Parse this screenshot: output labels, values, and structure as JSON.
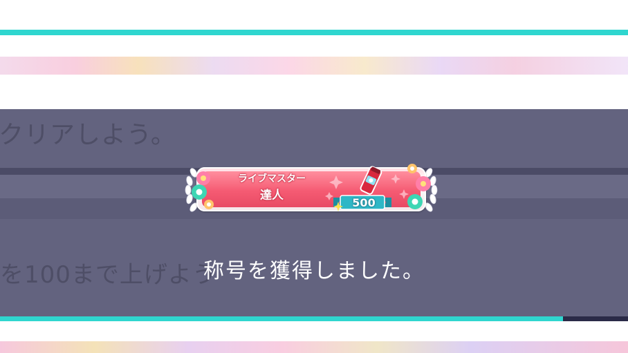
{
  "background": {
    "mission_text_1": "クリアしよう。",
    "mission_text_2": "を100まで上げよう",
    "progress": 0.896
  },
  "badge": {
    "line1": "ライブマスター",
    "line2": "達人",
    "value": "500",
    "icon": "stamina-drink-icon"
  },
  "message": "称号を獲得しました。",
  "colors": {
    "accent_teal": "#2fd6cf",
    "overlay": "#63637f",
    "badge_red": "#f55b73"
  }
}
